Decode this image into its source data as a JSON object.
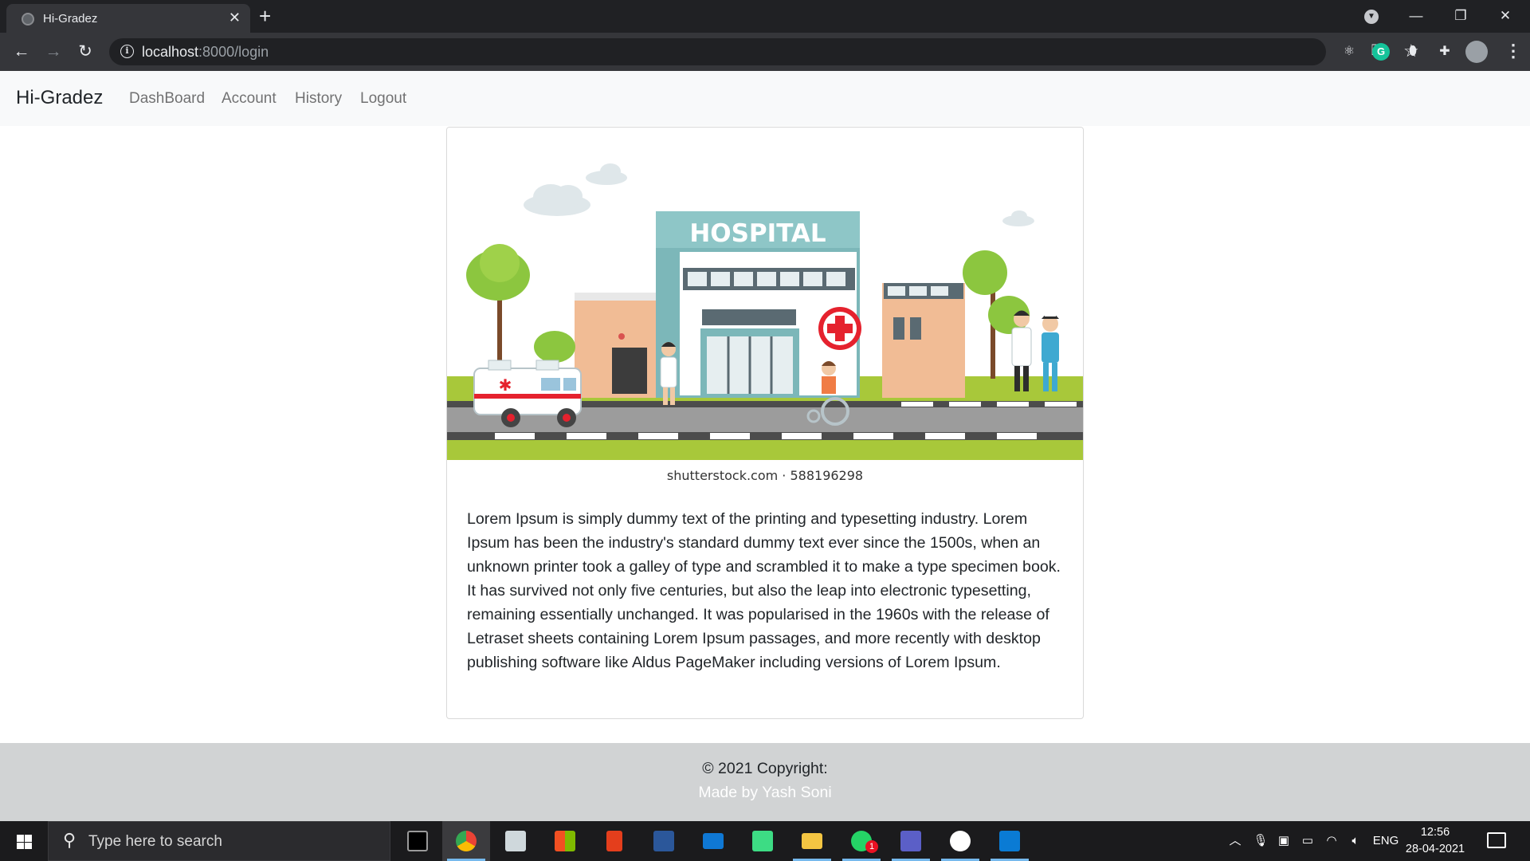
{
  "browser": {
    "tab_title": "Hi-Gradez",
    "url_host": "localhost",
    "url_path": ":8000/login"
  },
  "navbar": {
    "brand": "Hi-Gradez",
    "links": [
      "DashBoard",
      "Account",
      "History",
      "Logout"
    ]
  },
  "card": {
    "image_sign": "HOSPITAL",
    "image_caption": "shutterstock.com · 588196298",
    "text": "Lorem Ipsum is simply dummy text of the printing and typesetting industry. Lorem Ipsum has been the industry's standard dummy text ever since the 1500s, when an unknown printer took a galley of type and scrambled it to make a type specimen book. It has survived not only five centuries, but also the leap into electronic typesetting, remaining essentially unchanged. It was popularised in the 1960s with the release of Letraset sheets containing Lorem Ipsum passages, and more recently with desktop publishing software like Aldus PageMaker including versions of Lorem Ipsum."
  },
  "footer": {
    "copyright": "© 2021 Copyright:",
    "made_by": "Made by Yash Soni"
  },
  "taskbar": {
    "search_placeholder": "Type here to search",
    "language": "ENG",
    "time": "12:56",
    "date": "28-04-2021",
    "whatsapp_badge": "1"
  },
  "colors": {
    "navbar_bg": "#f8f9fa",
    "footer_bg": "#d1d3d4",
    "chrome_dark": "#202124",
    "taskbar": "#1b1b1d"
  }
}
